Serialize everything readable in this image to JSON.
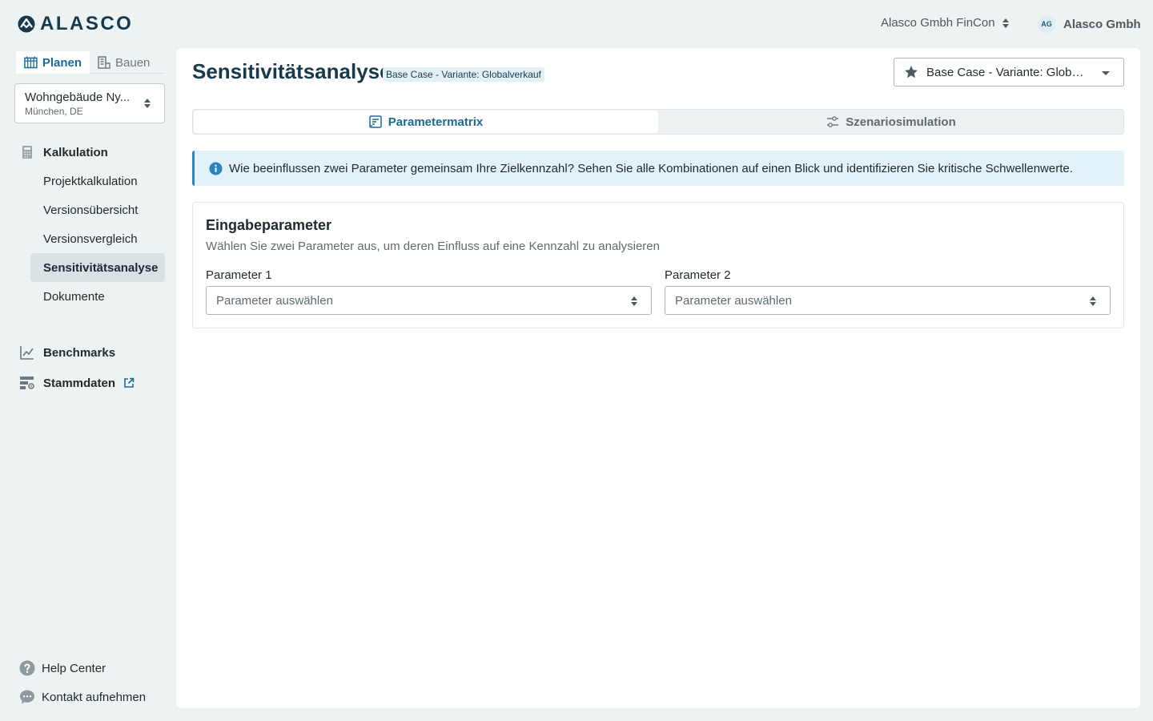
{
  "header": {
    "logo_text": "ALASCO",
    "org_switch_label": "Alasco Gmbh FinCon",
    "user_initials": "AG",
    "user_name": "Alasco Gmbh"
  },
  "sidebar": {
    "mode_tabs": [
      {
        "label": "Planen",
        "icon": "planning-icon",
        "active": true
      },
      {
        "label": "Bauen",
        "icon": "building-icon",
        "active": false
      }
    ],
    "project": {
      "name": "Wohngebäude Ny...",
      "location": "München, DE"
    },
    "groups": {
      "kalkulation": "Kalkulation",
      "benchmarks": "Benchmarks",
      "stammdaten": "Stammdaten"
    },
    "items": [
      {
        "label": "Projektkalkulation",
        "active": false
      },
      {
        "label": "Versionsübersicht",
        "active": false
      },
      {
        "label": "Versionsvergleich",
        "active": false
      },
      {
        "label": "Sensitivitätsanalyse",
        "active": true
      },
      {
        "label": "Dokumente",
        "active": false
      }
    ],
    "footer": {
      "help": "Help Center",
      "contact": "Kontakt aufnehmen"
    }
  },
  "main": {
    "title": "Sensitivitätsanalyse",
    "badge": "Base Case - Variante: Globalverkauf",
    "variant_select": "Base Case - Variante: Globalverkauf",
    "tabs": [
      {
        "label": "Parametermatrix",
        "active": true
      },
      {
        "label": "Szenariosimulation",
        "active": false
      }
    ],
    "info": "Wie beeinflussen zwei Parameter gemeinsam Ihre Zielkennzahl? Sehen Sie alle Kombinationen auf einen Blick und identifizieren Sie kritische Schwellenwerte.",
    "card": {
      "title": "Eingabeparameter",
      "subtitle": "Wählen Sie zwei Parameter aus, um deren Einfluss auf eine Kennzahl zu analysieren",
      "param1_label": "Parameter 1",
      "param1_placeholder": "Parameter auswählen",
      "param2_label": "Parameter 2",
      "param2_placeholder": "Parameter auswählen"
    }
  },
  "colors": {
    "brand": "#17394d",
    "accent": "#1c6a96",
    "info_border": "#2b84bd",
    "background": "#edf2f2"
  }
}
